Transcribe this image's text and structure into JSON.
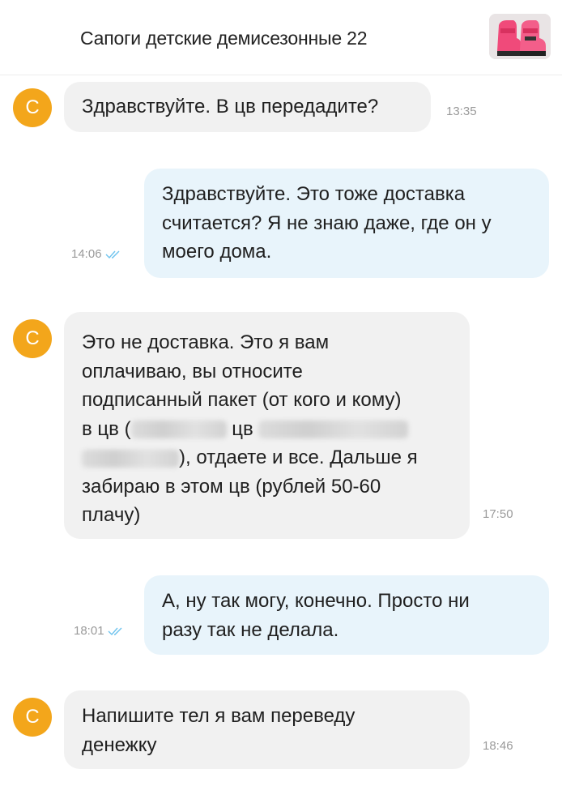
{
  "header": {
    "title": "Сапоги детские демисезонные 22",
    "thumbnail_icon": "pink-boots-product-photo"
  },
  "avatar": {
    "letter": "С",
    "color": "#f3a61b"
  },
  "colors": {
    "incoming_bubble": "#f1f1f1",
    "outgoing_bubble": "#e8f4fb",
    "read_check": "#6ec3ee"
  },
  "messages": [
    {
      "direction": "incoming",
      "lines": [
        "Здравствуйте. В цв передадите?"
      ],
      "time": "13:35"
    },
    {
      "direction": "outgoing",
      "lines": [
        "Здравствуйте. Это тоже доставка",
        "считается? Я не знаю даже, где он у",
        "моего дома."
      ],
      "time": "14:06",
      "read": true
    },
    {
      "direction": "incoming",
      "lines": [
        "Это не доставка. Это я вам",
        "оплачиваю, вы относите",
        "подписанный пакет (от кого и кому)",
        "в цв (",
        "цв",
        "), отдаете и все. Дальше я",
        "забираю в этом цв (рублей 50-60",
        "плачу)"
      ],
      "time": "17:50"
    },
    {
      "direction": "outgoing",
      "lines": [
        "А, ну так могу, конечно. Просто ни",
        "разу так не делала."
      ],
      "time": "18:01",
      "read": true
    },
    {
      "direction": "incoming",
      "lines": [
        "Напишите тел я вам переведу",
        "денежку"
      ],
      "time": "18:46"
    }
  ]
}
